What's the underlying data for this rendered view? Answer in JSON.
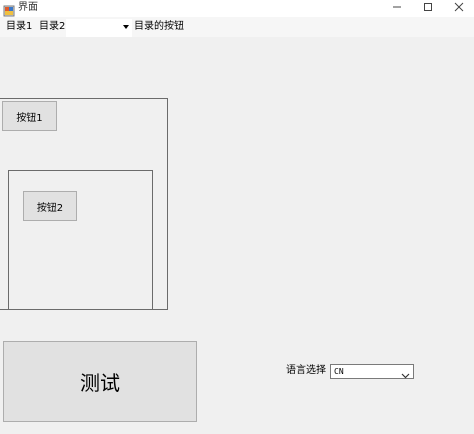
{
  "window": {
    "title": "界面",
    "icons": [
      "app-icon",
      "minimize-icon",
      "maximize-icon",
      "close-icon"
    ]
  },
  "menubar": {
    "item1": "目录1",
    "item2": "目录2",
    "combo_value": "",
    "button_label": "目录的按钮"
  },
  "buttons": {
    "button1": "按钮1",
    "button2": "按钮2",
    "test": "测试"
  },
  "language": {
    "label": "语言选择",
    "selected": "CN"
  }
}
